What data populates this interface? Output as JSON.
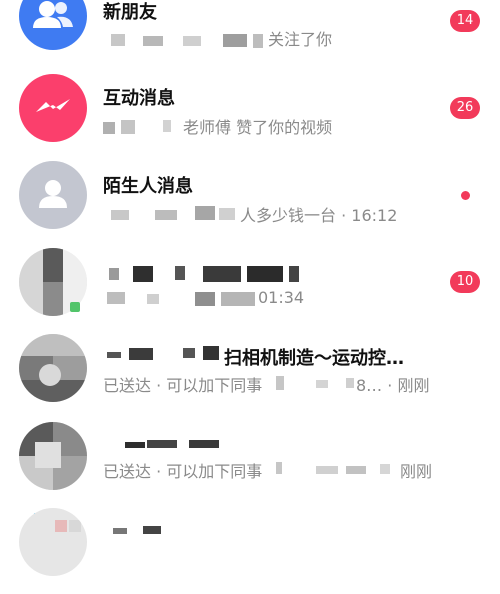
{
  "messages": [
    {
      "title": "新朋友",
      "sub": "关注了你",
      "badge": "14"
    },
    {
      "title": "互动消息",
      "sub": "老师傅 赞了你的视频",
      "badge": "26"
    },
    {
      "title": "陌生人消息",
      "sub": "人多少钱一台 · 16:12"
    },
    {
      "title": "",
      "sub": "01:34",
      "badge": "10"
    },
    {
      "title": "扫相机制造～运动控…",
      "sub_left": "已送达 · 可以加下同事",
      "sub_right": "8… · 刚刚"
    },
    {
      "title": "",
      "sub_left": "已送达 · 可以加下同事",
      "sub_right": "刚刚"
    }
  ],
  "icons": {
    "new_friends": "people-icon",
    "interactions": "messenger-bolt-icon",
    "strangers": "person-icon"
  },
  "colors": {
    "accent_blue": "#3f7bf2",
    "accent_pink": "#fb3f6c",
    "badge_red": "#f23a5a"
  }
}
